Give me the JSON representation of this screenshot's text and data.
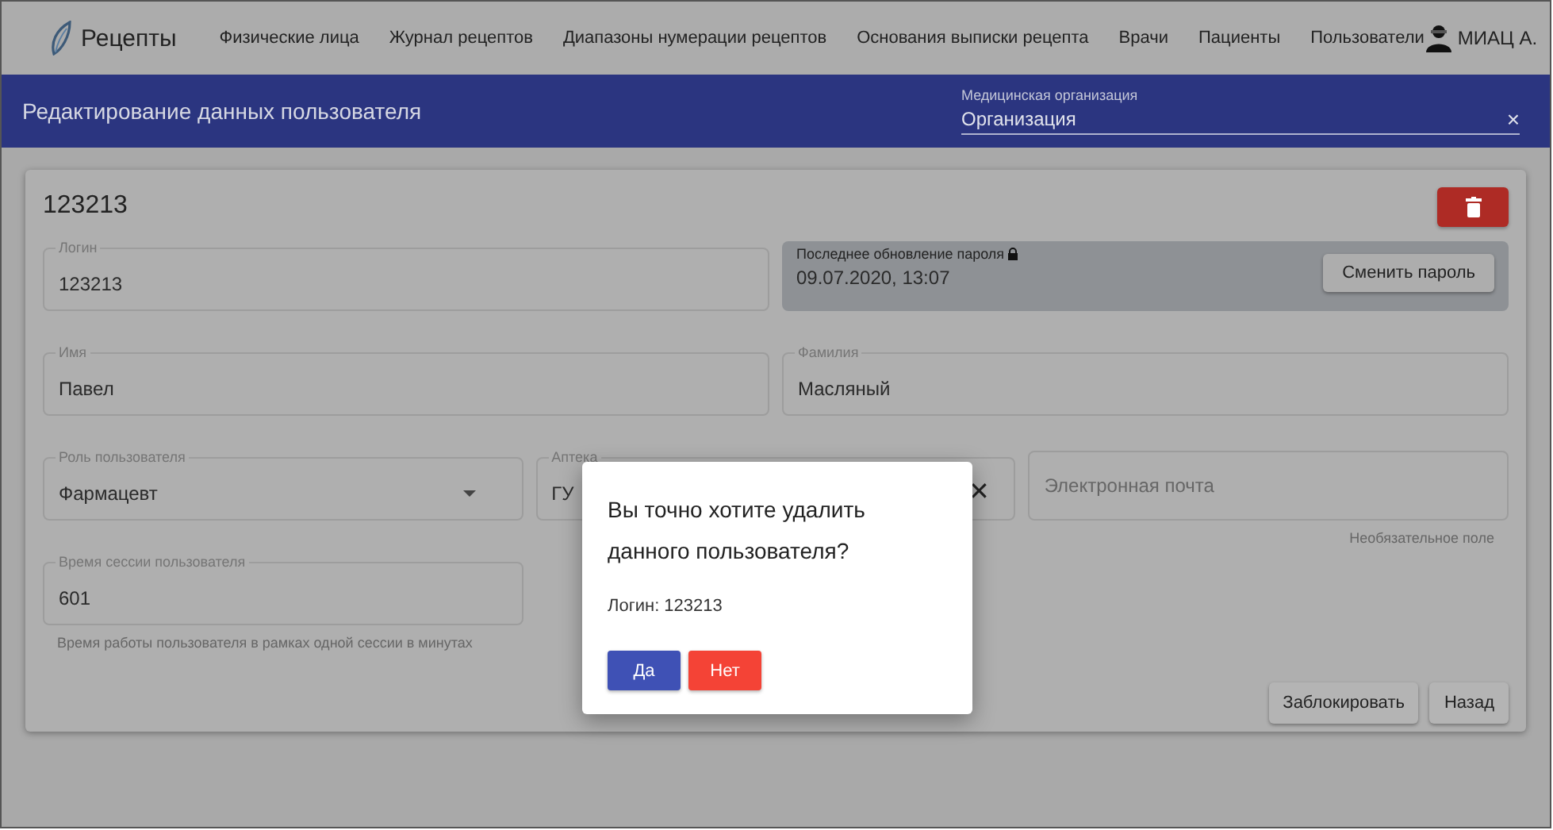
{
  "app": {
    "name": "Рецепты"
  },
  "nav": [
    {
      "label": "Физические лица"
    },
    {
      "label": "Журнал рецептов"
    },
    {
      "label": "Диапазоны нумерации рецептов"
    },
    {
      "label": "Основания выписки рецепта"
    },
    {
      "label": "Врачи"
    },
    {
      "label": "Пациенты"
    },
    {
      "label": "Пользователи"
    }
  ],
  "user": {
    "name": "МИАЦ А."
  },
  "page_header": {
    "title": "Редактирование данных пользователя",
    "org_label": "Медицинская организация",
    "org_value": "Организация",
    "clear": "×"
  },
  "card": {
    "title": "123213",
    "rows": [
      [
        {
          "kind": "text",
          "label": "Логин",
          "value": "123213"
        },
        {
          "kind": "locked",
          "label": "Последнее обновление пароля",
          "value": "09.07.2020, 13:07",
          "button": "Сменить пароль"
        }
      ],
      [
        {
          "kind": "text",
          "label": "Имя",
          "value": "Павел"
        },
        {
          "kind": "text",
          "label": "Фамилия",
          "value": "Масляный"
        }
      ],
      [
        {
          "kind": "select",
          "label": "Роль пользователя",
          "value": "Фармацевт"
        },
        {
          "kind": "clearable",
          "label": "Аптека",
          "value": "ГУ",
          "clear": "✕"
        },
        {
          "kind": "empty",
          "placeholder": "Электронная почта",
          "hint": "Необязательное поле"
        }
      ],
      [
        {
          "kind": "text",
          "label": "Время сессии пользователя",
          "value": "601",
          "hint": "Время работы пользователя в рамках одной сессии в минутах"
        }
      ]
    ],
    "buttons": [
      "Заблокировать",
      "Назад"
    ]
  },
  "dialog": {
    "question": "Вы точно хотите удалить данного пользователя?",
    "detail": "Логин: 123213",
    "buttons": [
      {
        "label": "Да",
        "kind": "confirm"
      },
      {
        "label": "Нет",
        "kind": "cancel"
      }
    ]
  }
}
